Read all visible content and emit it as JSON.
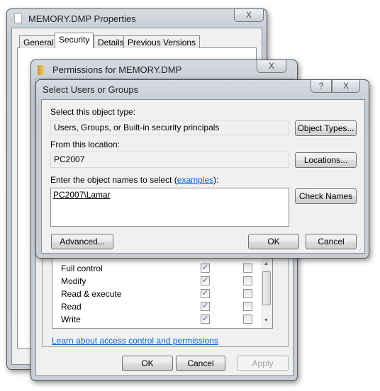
{
  "properties": {
    "title": "MEMORY.DMP Properties",
    "close": "X",
    "tabs": [
      {
        "label": "General"
      },
      {
        "label": "Security"
      },
      {
        "label": "Details"
      },
      {
        "label": "Previous Versions"
      }
    ],
    "active_tab": "Security"
  },
  "permissions": {
    "title": "Permissions for MEMORY.DMP",
    "close": "X",
    "rows": [
      {
        "label": "Full control",
        "allow": true,
        "deny": false
      },
      {
        "label": "Modify",
        "allow": true,
        "deny": false
      },
      {
        "label": "Read & execute",
        "allow": true,
        "deny": false
      },
      {
        "label": "Read",
        "allow": true,
        "deny": false
      },
      {
        "label": "Write",
        "allow": true,
        "deny": false
      }
    ],
    "link": "Learn about access control and permissions",
    "ok": "OK",
    "cancel": "Cancel",
    "apply": "Apply"
  },
  "select": {
    "title": "Select Users or Groups",
    "help": "?",
    "close": "X",
    "object_type_label": "Select this object type:",
    "object_type_value": "Users, Groups, or Built-in security principals",
    "object_types_button": "Object Types...",
    "location_label": "From this location:",
    "location_value": "PC2007",
    "locations_button": "Locations...",
    "names_label_prefix": "Enter the object names to select (",
    "names_label_link": "examples",
    "names_label_suffix": "):",
    "names_value": "PC2007\\Lamar",
    "check_names_button": "Check Names",
    "advanced_button": "Advanced...",
    "ok": "OK",
    "cancel": "Cancel"
  }
}
